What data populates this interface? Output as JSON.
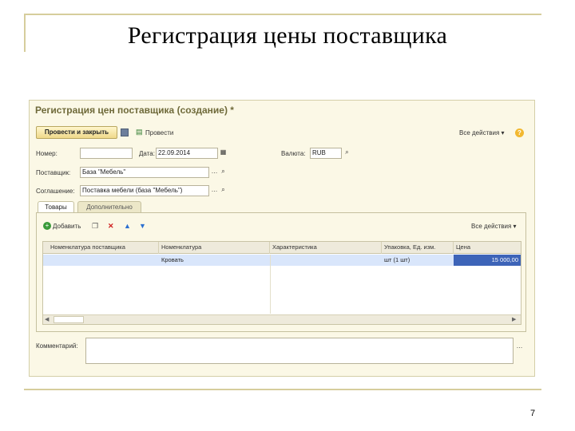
{
  "slide": {
    "title": "Регистрация цены поставщика",
    "page_number": "7"
  },
  "form": {
    "title": "Регистрация цен поставщика (создание) *",
    "toolbar": {
      "post_close_label": "Провести и закрыть",
      "post_label": "Провести",
      "all_actions_label": "Все действия ▾",
      "help_label": "?"
    },
    "fields": {
      "number_label": "Номер:",
      "number_value": "",
      "date_label": "Дата:",
      "date_value": "22.09.2014",
      "currency_label": "Валюта:",
      "currency_value": "RUB",
      "supplier_label": "Поставщик:",
      "supplier_value": "База \"Мебель\"",
      "agreement_label": "Соглашение:",
      "agreement_value": "Поставка мебели (база \"Мебель\")",
      "comment_label": "Комментарий:",
      "comment_value": ""
    },
    "tabs": [
      {
        "label": "Товары"
      },
      {
        "label": "Дополнительно"
      }
    ],
    "table_toolbar": {
      "add_label": "Добавить",
      "all_actions_label": "Все действия ▾"
    },
    "table": {
      "columns": [
        "Номенклатура поставщика",
        "Номенклатура",
        "Характеристика",
        "Упаковка, Ед. изм.",
        "Цена"
      ],
      "rows": [
        {
          "supplier_item": "",
          "item": "Кровать",
          "characteristic": "",
          "package": "шт (1 шт)",
          "price": "15 000,00"
        }
      ]
    },
    "icons": {
      "save": "floppy-disk-icon",
      "post": "post-document-icon",
      "add": "add-plus-icon",
      "copy": "copy-icon",
      "delete": "delete-x-icon",
      "up": "arrow-up-icon",
      "down": "arrow-down-icon",
      "calendar": "calendar-icon",
      "select": "ellipsis-icon",
      "open": "magnifier-icon"
    },
    "colors": {
      "accent": "#efd98a",
      "selected_row": "#d9e6fb",
      "selected_cell": "#3d64b8",
      "window_bg": "#fbf8e6"
    }
  }
}
